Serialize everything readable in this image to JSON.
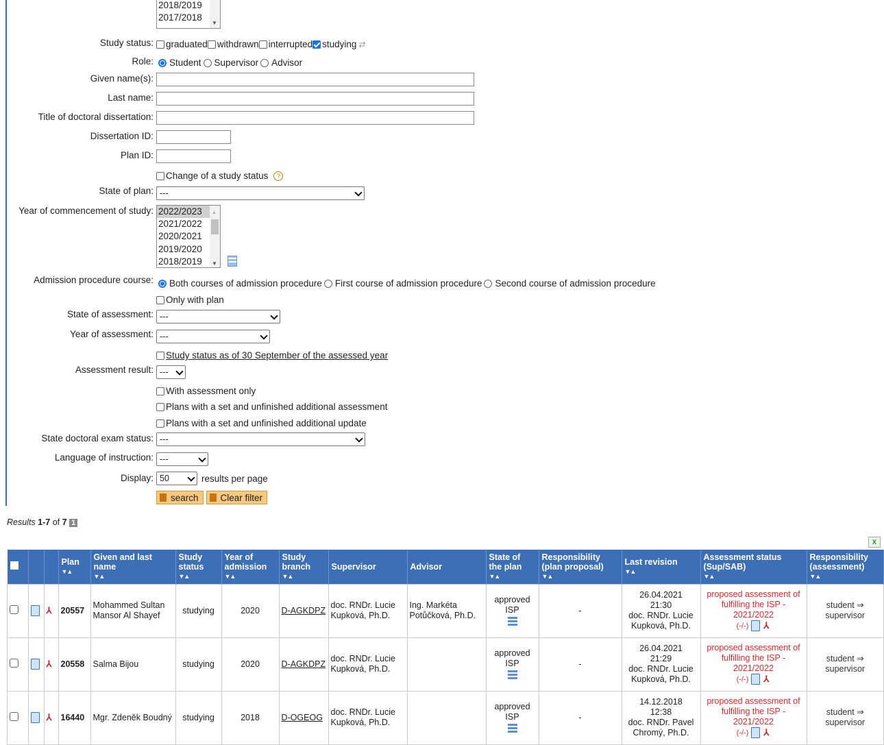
{
  "filter": {
    "year_list_top": [
      "2018/2019",
      "2017/2018"
    ],
    "study_status": {
      "label": "Study status:",
      "options": [
        {
          "text": "graduated",
          "checked": false
        },
        {
          "text": "withdrawn",
          "checked": false
        },
        {
          "text": "interrupted",
          "checked": false
        },
        {
          "text": "studying",
          "checked": true
        }
      ]
    },
    "role": {
      "label": "Role:",
      "options": [
        {
          "text": "Student",
          "checked": true
        },
        {
          "text": "Supervisor",
          "checked": false
        },
        {
          "text": "Advisor",
          "checked": false
        }
      ]
    },
    "given_names_label": "Given name(s):",
    "last_name_label": "Last name:",
    "title_label": "Title of doctoral dissertation:",
    "dissertation_id_label": "Dissertation ID:",
    "plan_id_label": "Plan ID:",
    "change_status_label": "Change of a study status",
    "state_of_plan": {
      "label": "State of plan:",
      "value": "---"
    },
    "year_commencement": {
      "label": "Year of commencement of study:",
      "options": [
        "2022/2023",
        "2021/2022",
        "2020/2021",
        "2019/2020",
        "2018/2019"
      ],
      "selected": "2022/2023"
    },
    "admission": {
      "label": "Admission procedure course:",
      "options": [
        {
          "text": "Both courses of admission procedure",
          "checked": true
        },
        {
          "text": "First course of admission procedure",
          "checked": false
        },
        {
          "text": "Second course of admission procedure",
          "checked": false
        }
      ]
    },
    "only_with_plan": "Only with plan",
    "state_assessment": {
      "label": "State of assessment:",
      "value": "---"
    },
    "year_assessment": {
      "label": "Year of assessment:",
      "value": "---"
    },
    "status_as_of": "Study status as of 30 September of the assessed year",
    "assessment_result": {
      "label": "Assessment result:",
      "value": "---"
    },
    "with_assessment_only": "With assessment only",
    "plans_additional_assessment": "Plans with a set and unfinished additional assessment",
    "plans_additional_update": "Plans with a set and unfinished additional update",
    "state_exam": {
      "label": "State doctoral exam status:",
      "value": "---"
    },
    "language": {
      "label": "Language of instruction:",
      "value": "---"
    },
    "display": {
      "label": "Display:",
      "value": "50",
      "suffix": "results per page"
    },
    "search_label": "search",
    "clear_label": "Clear filter"
  },
  "results": {
    "prefix": "Results",
    "range": "1-7",
    "of": "of",
    "total": "7",
    "page": "1"
  },
  "table": {
    "headers": [
      "Plan",
      "Given and last name",
      "Study status",
      "Year of admission",
      "Study branch",
      "Supervisor",
      "Advisor",
      "State of the plan",
      "Responsibility (plan proposal)",
      "Last revision",
      "Assessment status (Sup/SAB)",
      "Responsibility (assessment)"
    ],
    "rows": [
      {
        "plan": "20557",
        "name": "Mohammed Sultan Mansor Al Shayef",
        "status": "studying",
        "year": "2020",
        "branch": "D-AGKDPZ",
        "supervisor": "doc. RNDr. Lucie Kupková, Ph.D.",
        "advisor": "Ing. Markéta Potůčková, Ph.D.",
        "state": "approved ISP",
        "resp_plan": "-",
        "revision_date": "26.04.2021",
        "revision_time": "21:30",
        "revision_by": "doc. RNDr. Lucie Kupková, Ph.D.",
        "assessment": "proposed assessment of fulfilling the ISP - 2021/2022",
        "assessment_marks": "(-/-)",
        "resp_assess": "student ⇒ supervisor"
      },
      {
        "plan": "20558",
        "name": "Salma Bijou",
        "status": "studying",
        "year": "2020",
        "branch": "D-AGKDPZ",
        "supervisor": "doc. RNDr. Lucie Kupková, Ph.D.",
        "advisor": "",
        "state": "approved ISP",
        "resp_plan": "-",
        "revision_date": "26.04.2021",
        "revision_time": "21:29",
        "revision_by": "doc. RNDr. Lucie Kupková, Ph.D.",
        "assessment": "proposed assessment of fulfilling the ISP - 2021/2022",
        "assessment_marks": "(-/-)",
        "resp_assess": "student ⇒ supervisor"
      },
      {
        "plan": "16440",
        "name": "Mgr. Zdeněk Boudný",
        "status": "studying",
        "year": "2018",
        "branch": "D-OGEOG",
        "supervisor": "doc. RNDr. Lucie Kupková, Ph.D.",
        "advisor": "",
        "state": "approved ISP",
        "resp_plan": "-",
        "revision_date": "14.12.2018",
        "revision_time": "12:38",
        "revision_by": "doc. RNDr. Pavel Chromý, Ph.D.",
        "assessment": "proposed assessment of fulfilling the ISP - 2021/2022",
        "assessment_marks": "(-/-)",
        "resp_assess": "student ⇒ supervisor"
      }
    ]
  }
}
